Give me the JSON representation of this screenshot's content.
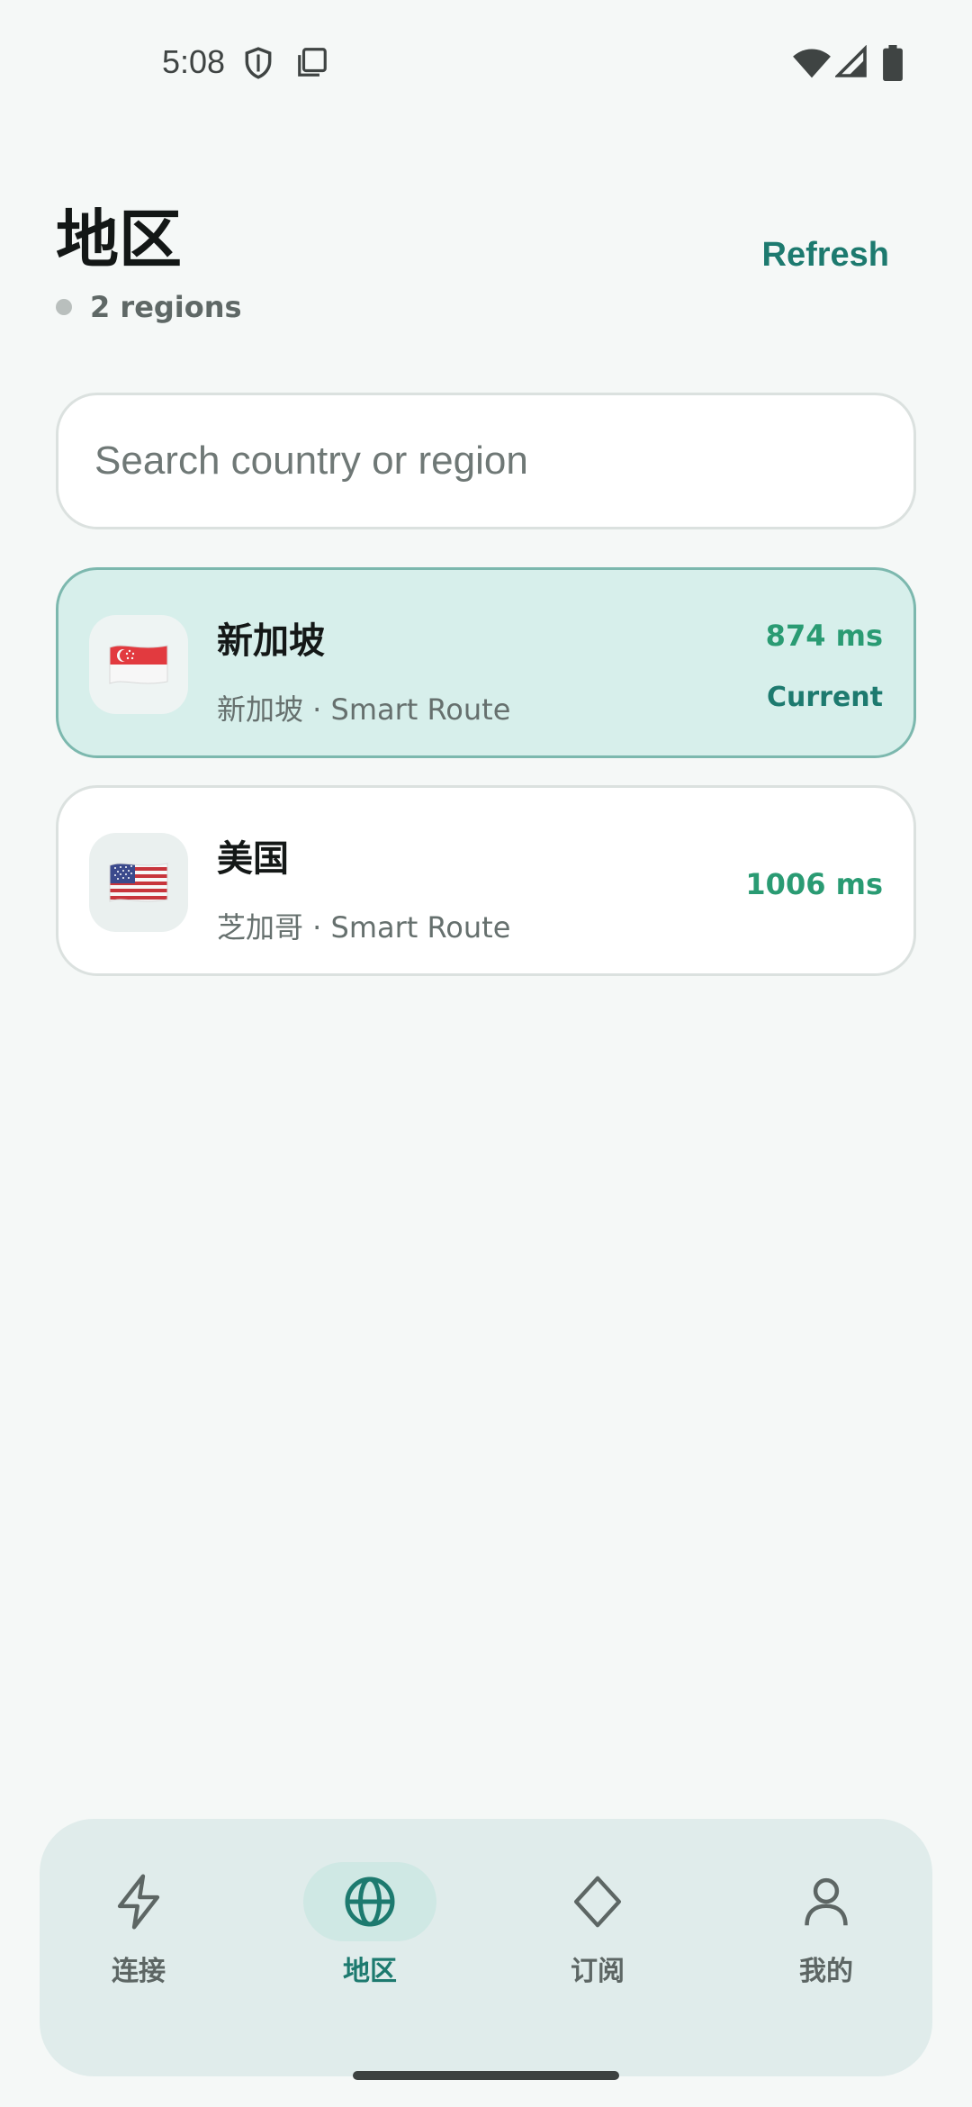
{
  "status_bar": {
    "time": "5:08",
    "icons": [
      "shield-icon",
      "screenshot-icon",
      "wifi-icon",
      "signal-icon",
      "battery-icon"
    ]
  },
  "header": {
    "title": "地区",
    "region_count": "2 regions",
    "refresh_label": "Refresh"
  },
  "search": {
    "placeholder": "Search country or region",
    "value": ""
  },
  "regions": [
    {
      "flag": "🇸🇬",
      "flag_icon": "singapore-flag-icon",
      "name": "新加坡",
      "subtitle": "新加坡 · Smart Route",
      "latency": "874 ms",
      "status": "Current",
      "selected": true
    },
    {
      "flag": "🇺🇸",
      "flag_icon": "us-flag-icon",
      "name": "美国",
      "subtitle": "芝加哥 · Smart Route",
      "latency": "1006 ms",
      "status": "",
      "selected": false
    }
  ],
  "bottom_nav": {
    "items": [
      {
        "label": "连接",
        "icon": "lightning-icon",
        "active": false
      },
      {
        "label": "地区",
        "icon": "globe-icon",
        "active": true
      },
      {
        "label": "订阅",
        "icon": "diamond-icon",
        "active": false
      },
      {
        "label": "我的",
        "icon": "person-icon",
        "active": false
      }
    ]
  },
  "colors": {
    "accent": "#1d7a6f",
    "latency_green": "#2a9b73",
    "selected_card_bg": "#d7efeb",
    "nav_bg": "#e0eceb",
    "background": "#f5f8f7"
  }
}
